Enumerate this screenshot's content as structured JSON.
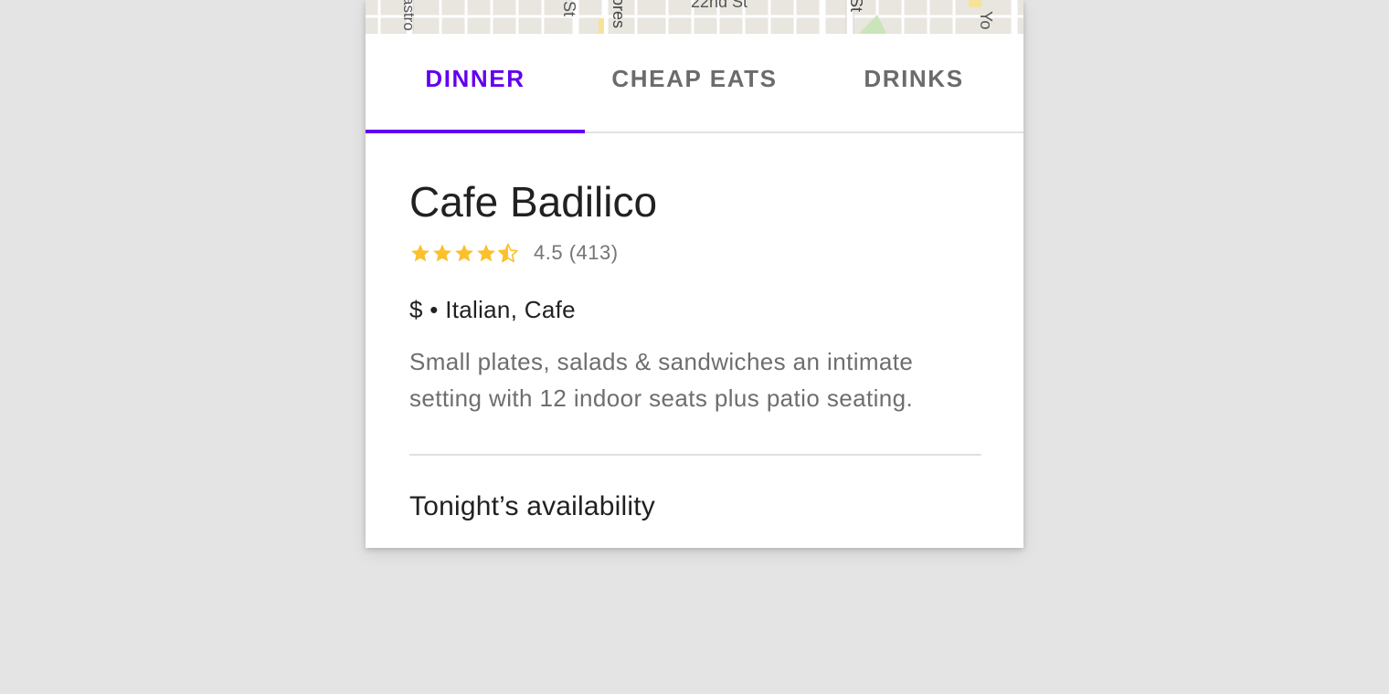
{
  "map": {
    "street_labels": [
      "astro",
      "h St",
      "ores",
      "22nd St",
      "St",
      "Yo"
    ]
  },
  "tabs": [
    {
      "label": "DINNER",
      "active": true
    },
    {
      "label": "CHEAP EATS",
      "active": false
    },
    {
      "label": "DRINKS",
      "active": false
    }
  ],
  "restaurant": {
    "name": "Cafe Badilico",
    "rating": 4.5,
    "rating_text": "4.5 (413)",
    "price_and_cuisine": "$ • Italian, Cafe",
    "description": "Small plates, salads & sandwiches an intimate setting with 12 indoor seats plus patio seating."
  },
  "availability": {
    "title": "Tonight’s availability"
  },
  "colors": {
    "accent": "#6200ee",
    "star": "#fbc02d",
    "background": "#e4e4e4"
  }
}
